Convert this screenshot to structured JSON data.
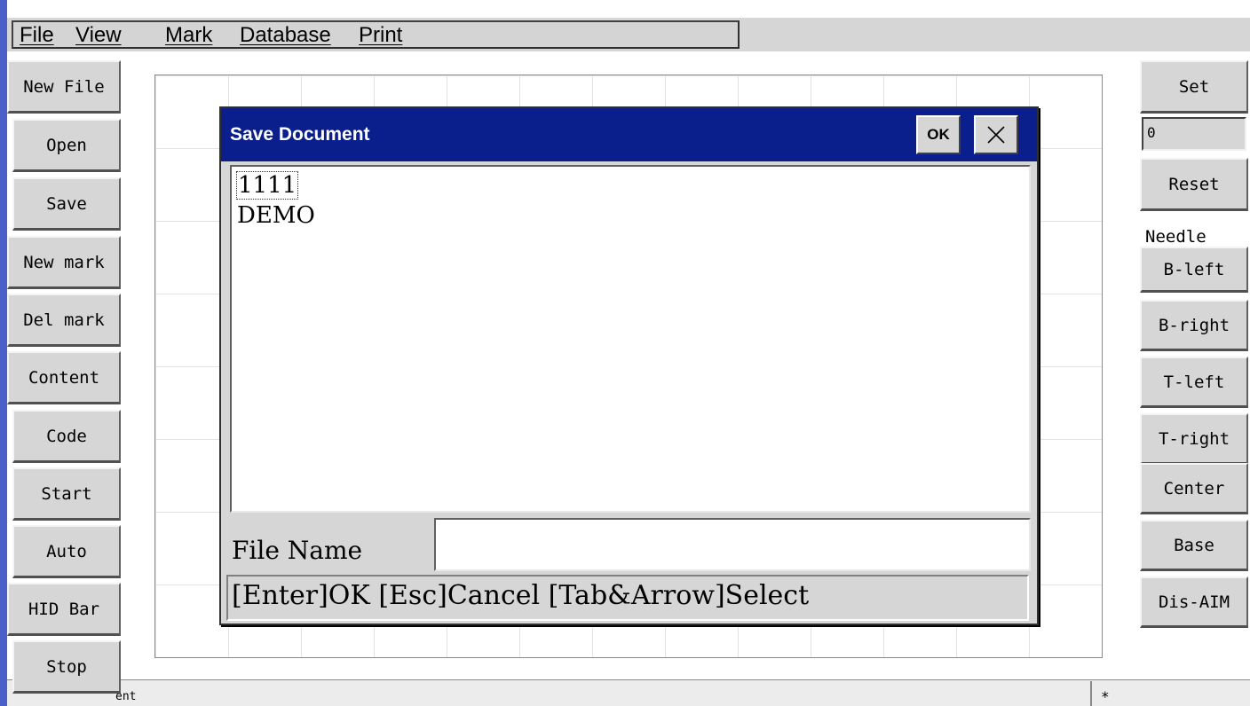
{
  "menu": {
    "items": [
      {
        "label": "File"
      },
      {
        "label": "View"
      },
      {
        "label": "Mark"
      },
      {
        "label": "Database"
      },
      {
        "label": "Print"
      }
    ]
  },
  "left_toolbar": {
    "buttons": [
      {
        "label": "New File"
      },
      {
        "label": "Open"
      },
      {
        "label": "Save"
      },
      {
        "label": "New mark"
      },
      {
        "label": "Del mark"
      },
      {
        "label": "Content"
      },
      {
        "label": "Code"
      },
      {
        "label": "Start"
      },
      {
        "label": "Auto"
      },
      {
        "label": "HID Bar"
      },
      {
        "label": "Stop"
      }
    ]
  },
  "right_toolbar": {
    "set_label": "Set",
    "value_field": "0",
    "reset_label": "Reset",
    "needle_label": "Needle",
    "buttons": [
      {
        "label": "B-left"
      },
      {
        "label": "B-right"
      },
      {
        "label": "T-left"
      },
      {
        "label": "T-right"
      },
      {
        "label": "Center"
      },
      {
        "label": "Base"
      },
      {
        "label": "Dis-AIM"
      }
    ]
  },
  "dialog": {
    "title": "Save Document",
    "ok_label": "OK",
    "close_icon": "close-icon",
    "files": [
      "1111",
      "DEMO"
    ],
    "file_name_label": "File Name",
    "file_name_value": "",
    "hint": "[Enter]OK [Esc]Cancel [Tab&Arrow]Select"
  },
  "status": {
    "left_text": "ent",
    "right_text": "*"
  },
  "colors": {
    "title_bar": "#0a1e8c",
    "button_face": "#d6d6d6",
    "left_accent": "#4a5fc8"
  }
}
